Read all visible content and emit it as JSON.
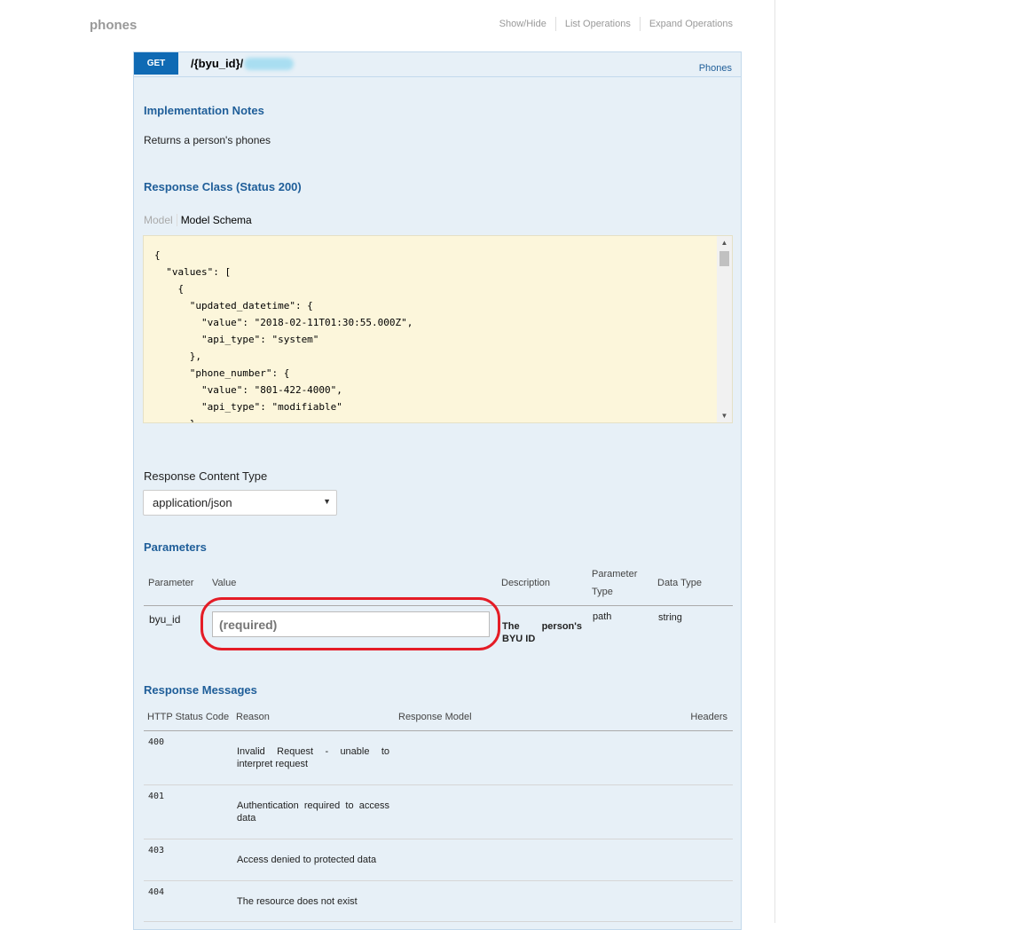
{
  "resource": {
    "title": "phones",
    "actions": [
      "Show/Hide",
      "List Operations",
      "Expand Operations"
    ]
  },
  "operation": {
    "method": "GET",
    "path": "/{byu_id}/",
    "tag": "Phones",
    "notes_heading": "Implementation Notes",
    "notes": "Returns a person's phones",
    "response_class_heading": "Response Class (Status 200)",
    "model_tab": "Model",
    "schema_tab": "Model Schema",
    "schema_text": "{\n  \"values\": [\n    {\n      \"updated_datetime\": {\n        \"value\": \"2018-02-11T01:30:55.000Z\",\n        \"api_type\": \"system\"\n      },\n      \"phone_number\": {\n        \"value\": \"801-422-4000\",\n        \"api_type\": \"modifiable\"\n      },",
    "content_type_label": "Response Content Type",
    "content_type_value": "application/json",
    "parameters_heading": "Parameters",
    "parameter_headers": [
      "Parameter",
      "Value",
      "Description",
      "Parameter Type",
      "Data Type"
    ],
    "parameters": [
      {
        "name": "byu_id",
        "placeholder": "(required)",
        "description": "The person's BYU ID",
        "param_type": "path",
        "data_type": "string"
      }
    ],
    "response_messages_heading": "Response Messages",
    "response_headers": [
      "HTTP Status Code",
      "Reason",
      "Response Model",
      "Headers"
    ],
    "responses": [
      {
        "code": "400",
        "reason": "Invalid Request - unable to interpret request"
      },
      {
        "code": "401",
        "reason": "Authentication required to access data"
      },
      {
        "code": "403",
        "reason": "Access denied to protected data"
      },
      {
        "code": "404",
        "reason": "The resource does not exist"
      }
    ]
  },
  "colors": {
    "method_get": "#0f6ab4",
    "heading": "#1f5e99",
    "operation_bg": "#e7f0f7",
    "schema_bg": "#fcf6db",
    "highlight": "#e41c26"
  }
}
